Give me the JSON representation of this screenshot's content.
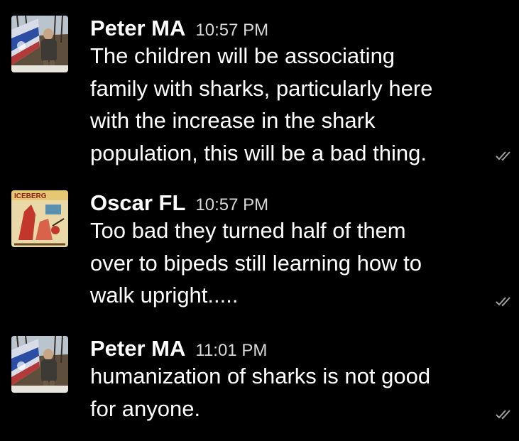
{
  "messages": [
    {
      "author": "Peter MA",
      "time": "10:57 PM",
      "avatar_icon": "person-with-flag-avatar",
      "lines": [
        "The children will be associating",
        "family with sharks, particularly here",
        "with the increase in the shark",
        "population, this will be a bad thing."
      ],
      "status_icon": "double-check-icon"
    },
    {
      "author": "Oscar FL",
      "time": "10:57 PM",
      "avatar_icon": "iceberg-comic-avatar",
      "avatar_text": "ICEBERG",
      "lines": [
        "Too bad they turned half of them",
        "over to bipeds still learning how to",
        "walk upright....."
      ],
      "status_icon": "double-check-icon"
    },
    {
      "author": "Peter MA",
      "time": "11:01 PM",
      "avatar_icon": "person-with-flag-avatar",
      "lines": [
        "humanization of sharks is not good",
        "for anyone."
      ],
      "status_icon": "double-check-icon"
    }
  ],
  "colors": {
    "background": "#000000",
    "text": "#ffffff",
    "timestamp": "#d8d8d8",
    "check": "#a0a0a0"
  }
}
